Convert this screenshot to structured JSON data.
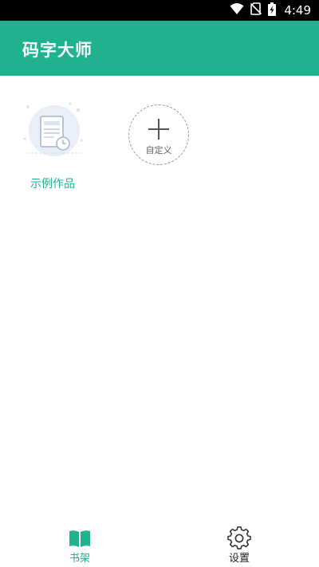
{
  "status_bar": {
    "time": "4:49",
    "icons": [
      "wifi-icon",
      "no-sim-icon",
      "battery-charging-icon"
    ]
  },
  "app_bar": {
    "title": "码字大师"
  },
  "shelf": {
    "items": [
      {
        "label": "示例作品",
        "icon": "document-clock-icon"
      }
    ],
    "add_button": {
      "label": "自定义",
      "icon": "plus-icon"
    }
  },
  "bottom_nav": {
    "items": [
      {
        "label": "书架",
        "icon": "open-book-icon",
        "active": true
      },
      {
        "label": "设置",
        "icon": "gear-icon",
        "active": false
      }
    ]
  },
  "colors": {
    "accent": "#20b28f",
    "status_bar_bg": "#000000",
    "background": "#ffffff",
    "inactive_text": "#222222"
  }
}
